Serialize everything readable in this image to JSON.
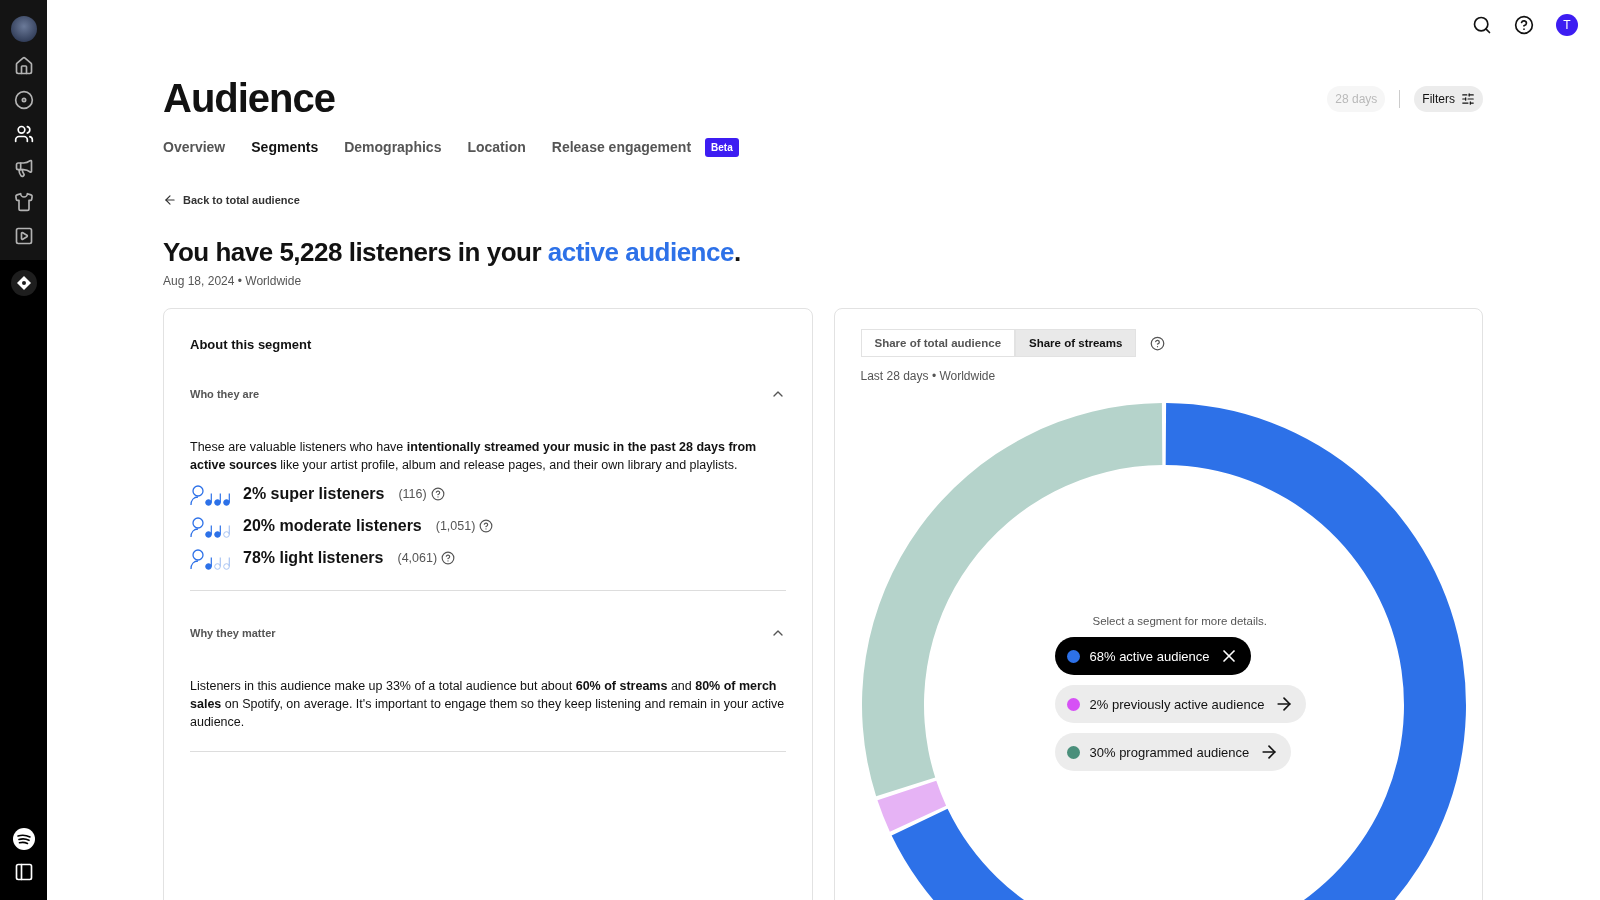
{
  "sidebar": {
    "items": [
      {
        "selected": false
      },
      {
        "selected": false
      },
      {
        "selected": true
      },
      {
        "selected": false
      },
      {
        "selected": false
      },
      {
        "selected": false
      }
    ]
  },
  "header": {
    "avatar_letter": "T"
  },
  "page": {
    "title": "Audience",
    "period": {
      "label": "28 days",
      "disabled": true
    },
    "filters": "Filters"
  },
  "tabs": [
    {
      "label": "Overview",
      "selected": false
    },
    {
      "label": "Segments",
      "selected": true
    },
    {
      "label": "Demographics",
      "selected": false
    },
    {
      "label": "Location",
      "selected": false
    },
    {
      "label": "Release engagement",
      "selected": false,
      "badge": "Beta"
    }
  ],
  "back_link": "Back to total audience",
  "headline": {
    "before": "You have 5,228 listeners in your ",
    "link": "active audience",
    "after": "."
  },
  "subtitle": "Aug 18, 2024 • Worldwide",
  "segment_card": {
    "title": "About this segment",
    "sections": [
      {
        "heading": "Who they are",
        "expanded": true,
        "text": "These are valuable listeners who have **intentionally streamed your music in the past 28 days from active sources** like your artist profile, album and release pages, and their own library and playlists.",
        "listeners": [
          {
            "label": "2% super listeners",
            "count": "(116)",
            "stars": 3
          },
          {
            "label": "20% moderate listeners",
            "count": "(1,051)",
            "stars": 2
          },
          {
            "label": "78% light listeners",
            "count": "(4,061)",
            "stars": 1
          }
        ]
      },
      {
        "heading": "Why they matter",
        "expanded": true,
        "text": "Listeners in this audience make up 33% of a total audience but about **60% of streams** and **80% of merch sales** on Spotify, on average. It's important to engage them so they keep listening and remain in your active audience."
      }
    ]
  },
  "chart_card": {
    "toggle": [
      {
        "label": "Share of total audience",
        "selected": false
      },
      {
        "label": "Share of streams",
        "selected": true
      }
    ],
    "subtitle": "Last 28 days • Worldwide",
    "hint": "Select a segment for more details.",
    "segments": [
      {
        "label": "68% active audience",
        "color": "#2d71e8",
        "selected": true
      },
      {
        "label": "2% previously active audience",
        "color": "#d651f5",
        "selected": false
      },
      {
        "label": "30% programmed audience",
        "color": "#4a8f7b",
        "selected": false
      }
    ],
    "chart_data": {
      "type": "donut",
      "values": [
        68,
        2,
        30
      ],
      "colors": [
        "#2d71e8",
        "#e6b3f5",
        "#b5d3cb"
      ]
    }
  }
}
